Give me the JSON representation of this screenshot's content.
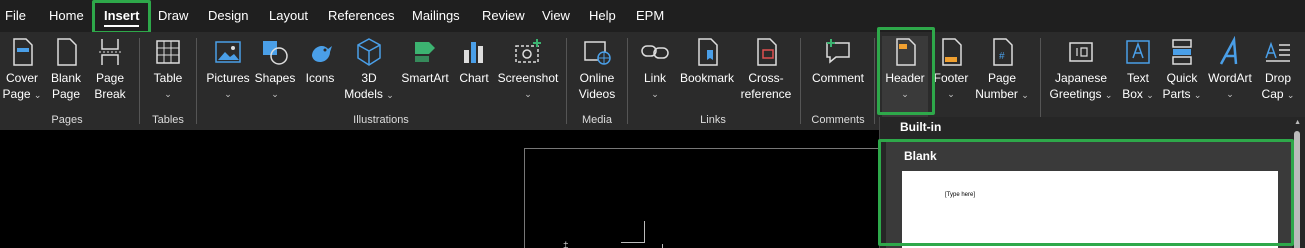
{
  "menu": {
    "items": [
      {
        "label": "File"
      },
      {
        "label": "Home"
      },
      {
        "label": "Insert"
      },
      {
        "label": "Draw"
      },
      {
        "label": "Design"
      },
      {
        "label": "Layout"
      },
      {
        "label": "References"
      },
      {
        "label": "Mailings"
      },
      {
        "label": "Review"
      },
      {
        "label": "View"
      },
      {
        "label": "Help"
      },
      {
        "label": "EPM"
      }
    ],
    "active": "Insert"
  },
  "ribbon": {
    "buttons": {
      "cover_page": {
        "l1": "Cover",
        "l2": "Page"
      },
      "blank_page": {
        "l1": "Blank",
        "l2": "Page"
      },
      "page_break": {
        "l1": "Page",
        "l2": "Break"
      },
      "table": {
        "l1": "Table"
      },
      "pictures": {
        "l1": "Pictures"
      },
      "shapes": {
        "l1": "Shapes"
      },
      "icons": {
        "l1": "Icons"
      },
      "models3d": {
        "l1": "3D",
        "l2": "Models"
      },
      "smartart": {
        "l1": "SmartArt"
      },
      "chart": {
        "l1": "Chart"
      },
      "screenshot": {
        "l1": "Screenshot"
      },
      "online_videos": {
        "l1": "Online",
        "l2": "Videos"
      },
      "link": {
        "l1": "Link"
      },
      "bookmark": {
        "l1": "Bookmark"
      },
      "cross_reference": {
        "l1": "Cross-",
        "l2": "reference"
      },
      "comment": {
        "l1": "Comment"
      },
      "header": {
        "l1": "Header"
      },
      "footer": {
        "l1": "Footer"
      },
      "page_number": {
        "l1": "Page",
        "l2": "Number"
      },
      "japanese_greetings": {
        "l1": "Japanese",
        "l2": "Greetings"
      },
      "text_box": {
        "l1": "Text",
        "l2": "Box"
      },
      "quick_parts": {
        "l1": "Quick",
        "l2": "Parts"
      },
      "wordart": {
        "l1": "WordArt"
      },
      "drop_cap": {
        "l1": "Drop",
        "l2": "Cap"
      }
    },
    "groups": {
      "pages": "Pages",
      "tables": "Tables",
      "illustrations": "Illustrations",
      "media": "Media",
      "links": "Links",
      "comments": "Comments"
    },
    "chevron": "⌄"
  },
  "gallery": {
    "section": "Built-in",
    "item_title": "Blank",
    "preview_text": "[Type here]"
  },
  "colors": {
    "accent": "#2ea84a",
    "icon_blue": "#4a9fe8",
    "icon_orange": "#f0a030",
    "icon_green": "#3cb371"
  }
}
